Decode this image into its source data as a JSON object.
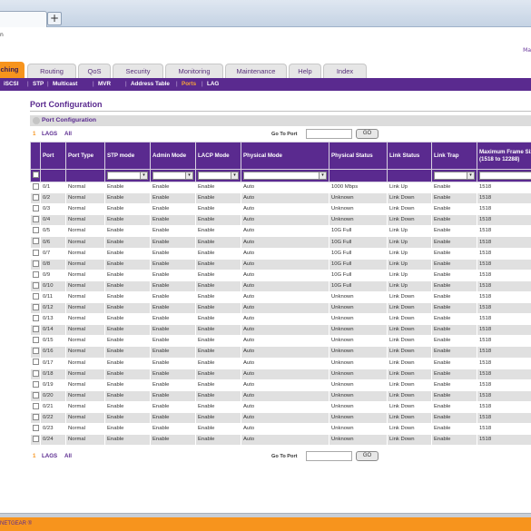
{
  "browser": {
    "new_tab_label": "+"
  },
  "page": {
    "top_mark": "n",
    "top_link": "Ma"
  },
  "nav_tabs": [
    {
      "label": "ching",
      "active": true
    },
    {
      "label": "Routing"
    },
    {
      "label": "QoS"
    },
    {
      "label": "Security"
    },
    {
      "label": "Monitoring"
    },
    {
      "label": "Maintenance"
    },
    {
      "label": "Help"
    },
    {
      "label": "Index"
    }
  ],
  "subnav": [
    {
      "label": "iSCSI"
    },
    {
      "label": "STP"
    },
    {
      "label": "Multicast"
    },
    {
      "label": "MVR"
    },
    {
      "label": "Address Table"
    },
    {
      "label": "Ports",
      "active": true
    },
    {
      "label": "LAG"
    }
  ],
  "page_title": "Port Configuration",
  "section_title": "Port Configuration",
  "filter": {
    "index": "1",
    "lags": "LAGS",
    "all": "All",
    "goto_label": "Go To Port",
    "go_button": "GO"
  },
  "table": {
    "headers": [
      "Port",
      "Port Type",
      "STP mode",
      "Admin Mode",
      "LACP Mode",
      "Physical Mode",
      "Physical Status",
      "Link Status",
      "Link Trap",
      "Maximum Frame Size (1518 to 12288)"
    ],
    "rows": [
      [
        "0/1",
        "Normal",
        "Enable",
        "Enable",
        "Enable",
        "Auto",
        "1000 Mbps",
        "Link Up",
        "Enable",
        "1518"
      ],
      [
        "0/2",
        "Normal",
        "Enable",
        "Enable",
        "Enable",
        "Auto",
        "Unknown",
        "Link Down",
        "Enable",
        "1518"
      ],
      [
        "0/3",
        "Normal",
        "Enable",
        "Enable",
        "Enable",
        "Auto",
        "Unknown",
        "Link Down",
        "Enable",
        "1518"
      ],
      [
        "0/4",
        "Normal",
        "Enable",
        "Enable",
        "Enable",
        "Auto",
        "Unknown",
        "Link Down",
        "Enable",
        "1518"
      ],
      [
        "0/5",
        "Normal",
        "Enable",
        "Enable",
        "Enable",
        "Auto",
        "10G Full",
        "Link Up",
        "Enable",
        "1518"
      ],
      [
        "0/6",
        "Normal",
        "Enable",
        "Enable",
        "Enable",
        "Auto",
        "10G Full",
        "Link Up",
        "Enable",
        "1518"
      ],
      [
        "0/7",
        "Normal",
        "Enable",
        "Enable",
        "Enable",
        "Auto",
        "10G Full",
        "Link Up",
        "Enable",
        "1518"
      ],
      [
        "0/8",
        "Normal",
        "Enable",
        "Enable",
        "Enable",
        "Auto",
        "10G Full",
        "Link Up",
        "Enable",
        "1518"
      ],
      [
        "0/9",
        "Normal",
        "Enable",
        "Enable",
        "Enable",
        "Auto",
        "10G Full",
        "Link Up",
        "Enable",
        "1518"
      ],
      [
        "0/10",
        "Normal",
        "Enable",
        "Enable",
        "Enable",
        "Auto",
        "10G Full",
        "Link Up",
        "Enable",
        "1518"
      ],
      [
        "0/11",
        "Normal",
        "Enable",
        "Enable",
        "Enable",
        "Auto",
        "Unknown",
        "Link Down",
        "Enable",
        "1518"
      ],
      [
        "0/12",
        "Normal",
        "Enable",
        "Enable",
        "Enable",
        "Auto",
        "Unknown",
        "Link Down",
        "Enable",
        "1518"
      ],
      [
        "0/13",
        "Normal",
        "Enable",
        "Enable",
        "Enable",
        "Auto",
        "Unknown",
        "Link Down",
        "Enable",
        "1518"
      ],
      [
        "0/14",
        "Normal",
        "Enable",
        "Enable",
        "Enable",
        "Auto",
        "Unknown",
        "Link Down",
        "Enable",
        "1518"
      ],
      [
        "0/15",
        "Normal",
        "Enable",
        "Enable",
        "Enable",
        "Auto",
        "Unknown",
        "Link Down",
        "Enable",
        "1518"
      ],
      [
        "0/16",
        "Normal",
        "Enable",
        "Enable",
        "Enable",
        "Auto",
        "Unknown",
        "Link Down",
        "Enable",
        "1518"
      ],
      [
        "0/17",
        "Normal",
        "Enable",
        "Enable",
        "Enable",
        "Auto",
        "Unknown",
        "Link Down",
        "Enable",
        "1518"
      ],
      [
        "0/18",
        "Normal",
        "Enable",
        "Enable",
        "Enable",
        "Auto",
        "Unknown",
        "Link Down",
        "Enable",
        "1518"
      ],
      [
        "0/19",
        "Normal",
        "Enable",
        "Enable",
        "Enable",
        "Auto",
        "Unknown",
        "Link Down",
        "Enable",
        "1518"
      ],
      [
        "0/20",
        "Normal",
        "Enable",
        "Enable",
        "Enable",
        "Auto",
        "Unknown",
        "Link Down",
        "Enable",
        "1518"
      ],
      [
        "0/21",
        "Normal",
        "Enable",
        "Enable",
        "Enable",
        "Auto",
        "Unknown",
        "Link Down",
        "Enable",
        "1518"
      ],
      [
        "0/22",
        "Normal",
        "Enable",
        "Enable",
        "Enable",
        "Auto",
        "Unknown",
        "Link Down",
        "Enable",
        "1518"
      ],
      [
        "0/23",
        "Normal",
        "Enable",
        "Enable",
        "Enable",
        "Auto",
        "Unknown",
        "Link Down",
        "Enable",
        "1518"
      ],
      [
        "0/24",
        "Normal",
        "Enable",
        "Enable",
        "Enable",
        "Auto",
        "Unknown",
        "Link Down",
        "Enable",
        "1518"
      ]
    ]
  },
  "status_bar": {
    "text": "NETGEAR ®"
  },
  "colors": {
    "brand_purple": "#5a2a8f",
    "accent_orange": "#f7941d",
    "row_alt": "#e0e0e0"
  },
  "icons": {
    "dropdown": "chevron-down-icon",
    "checkbox": "checkbox-icon",
    "bullet": "section-bullet-icon"
  }
}
